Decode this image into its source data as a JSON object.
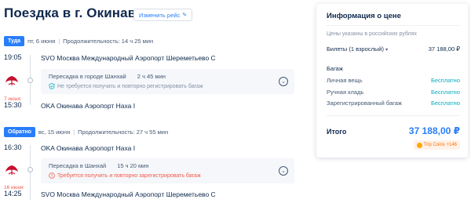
{
  "header": {
    "title": "Поездка в г. Окинава",
    "change_label": "Изменить рейс"
  },
  "outbound": {
    "badge": "Туда",
    "date": "пт, 6 июня",
    "duration": "Продолжительность: 14 ч 25 мин",
    "dep_time": "19:05",
    "dep_airport": "SVO Москва Международный Аэропорт Шереметьево C",
    "transfer_city": "Пересадка в городе Шанхай",
    "transfer_time": "2 ч 45 мин",
    "transfer_note": "Не требуется получать и повторно регистрировать багаж",
    "arr_date": "7 июня",
    "arr_time": "15:30",
    "arr_airport": "OKA Окинава Аэропорт Наха I"
  },
  "return": {
    "badge": "Обратно",
    "date": "вс, 15 июня",
    "duration": "Продолжительность: 27 ч 55 мин",
    "dep_time": "16:30",
    "dep_airport": "OKA Окинава Аэропорт Наха I",
    "transfer_city": "Пересадка в Шанхай",
    "transfer_time": "15 ч 20 мин",
    "transfer_note": "Требуется получить и повторно зарегистрировать багаж",
    "arr_date": "16 июня",
    "arr_time": "14:25",
    "arr_airport": "SVO Москва Международный Аэропорт Шереметьево C"
  },
  "price": {
    "title": "Информация о цене",
    "currency_note": "Цены указаны в российских рублях",
    "tickets_label": "Билеты (1 взрослый)",
    "tickets_value": "37 188,00 ₽",
    "baggage_title": "Багаж",
    "baggage": [
      {
        "label": "Личная вещь",
        "value": "Бесплатно"
      },
      {
        "label": "Ручная кладь",
        "value": "Бесплатно"
      },
      {
        "label": "Зарегистрированный багаж",
        "value": "Бесплатно"
      }
    ],
    "total_label": "Итого",
    "total_value": "37 188,00 ₽",
    "coins": "Trip Coins +146"
  },
  "colors": {
    "accent": "#287dfa",
    "warning": "#f5594a",
    "free": "#06aebd",
    "airline": "#c8102e"
  }
}
